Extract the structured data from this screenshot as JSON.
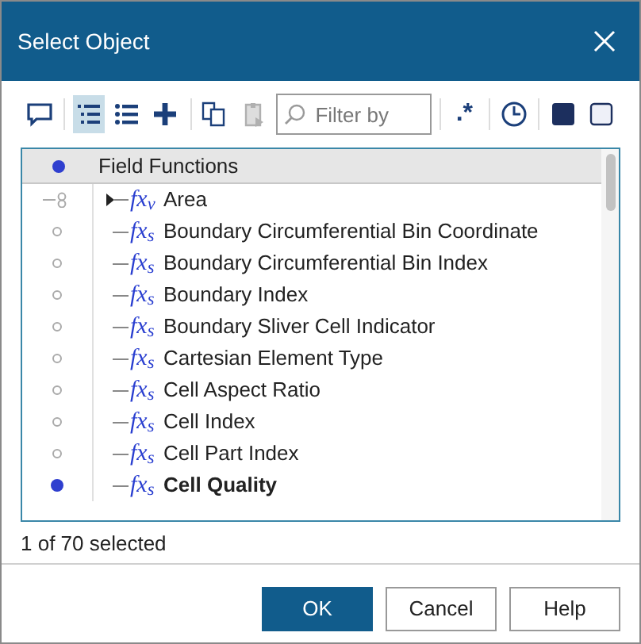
{
  "window": {
    "title": "Select Object"
  },
  "toolbar": [
    {
      "kind": "comment",
      "selected": false,
      "disabled": false
    },
    {
      "kind": "tree",
      "selected": true,
      "disabled": false
    },
    {
      "kind": "list",
      "selected": false,
      "disabled": false
    },
    {
      "kind": "add",
      "selected": false,
      "disabled": false
    },
    {
      "kind": "copy",
      "selected": false,
      "disabled": false
    },
    {
      "kind": "paste",
      "selected": false,
      "disabled": true
    },
    {
      "kind": "filter",
      "placeholder": "Filter by"
    },
    {
      "kind": "regex",
      "label": ".*",
      "selected": false,
      "disabled": false
    },
    {
      "kind": "clock",
      "selected": false,
      "disabled": false
    },
    {
      "kind": "fill",
      "selected": false,
      "disabled": false
    },
    {
      "kind": "empty",
      "selected": false,
      "disabled": false
    }
  ],
  "tree": {
    "header": {
      "label": "Field Functions",
      "selected": true
    },
    "items": [
      {
        "label": "Area",
        "icon_label": "fx$_{v}$",
        "kind": "group",
        "expanded": false,
        "selected": false
      },
      {
        "label": "Boundary Circumferential Bin Coordinate",
        "icon_label": "fx$_{s}$",
        "kind": "leaf",
        "selected": false
      },
      {
        "label": "Boundary Circumferential Bin Index",
        "icon_label": "fx$_{s}$",
        "kind": "leaf",
        "selected": false
      },
      {
        "label": "Boundary Index",
        "icon_label": "fx$_{s}$",
        "kind": "leaf",
        "selected": false
      },
      {
        "label": "Boundary Sliver Cell Indicator",
        "icon_label": "fx$_{s}$",
        "kind": "leaf",
        "selected": false
      },
      {
        "label": "Cartesian Element Type",
        "icon_label": "fx$_{s}$",
        "kind": "leaf",
        "selected": false
      },
      {
        "label": "Cell Aspect Ratio",
        "icon_label": "fx$_{s}$",
        "kind": "leaf",
        "selected": false
      },
      {
        "label": "Cell Index",
        "icon_label": "fx$_{s}$",
        "kind": "leaf",
        "selected": false
      },
      {
        "label": "Cell Part Index",
        "icon_label": "fx$_{s}$",
        "kind": "leaf",
        "selected": false
      },
      {
        "label": "Cell Quality",
        "icon_label": "fx$_{s}$",
        "kind": "leaf",
        "selected": true
      }
    ]
  },
  "status": "1 of 70 selected",
  "buttons": [
    {
      "label": "OK",
      "kind": "primary"
    },
    {
      "label": "Cancel",
      "kind": "normal"
    },
    {
      "label": "Help",
      "kind": "normal"
    }
  ]
}
